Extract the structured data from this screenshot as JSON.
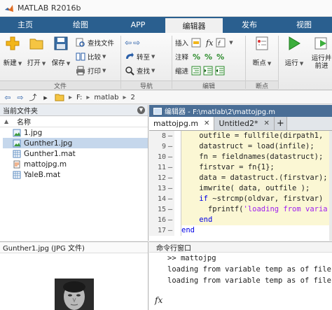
{
  "window": {
    "title": "MATLAB R2016b"
  },
  "tabs": [
    {
      "label": "主页",
      "active": false
    },
    {
      "label": "绘图",
      "active": false
    },
    {
      "label": "APP",
      "active": false
    },
    {
      "label": "编辑器",
      "active": true
    },
    {
      "label": "发布",
      "active": false
    },
    {
      "label": "视图",
      "active": false
    }
  ],
  "ribbon": {
    "new_label": "新建",
    "open_label": "打开",
    "save_label": "保存",
    "find_files_label": "查找文件",
    "compare_label": "比较",
    "print_label": "打印",
    "goto_label": "转至",
    "find_label": "查找",
    "insert_label": "插入",
    "comment_label": "注释",
    "indent_label": "缩进",
    "breakpoints_label": "断点",
    "run_label": "运行",
    "run_advance_label": "运行并\n前进",
    "group_file": "文件",
    "group_nav": "导航",
    "group_edit": "编辑",
    "group_breakpoints": "断点"
  },
  "address": {
    "drive": "F:",
    "sep1": "▸",
    "folder1": "matlab",
    "sep2": "▸",
    "folder2": "2"
  },
  "current_folder": {
    "title": "当前文件夹",
    "column_name": "名称",
    "column_sort": "▲",
    "files": [
      {
        "name": "1.jpg",
        "type": "jpg",
        "selected": false
      },
      {
        "name": "Gunther1.jpg",
        "type": "jpg",
        "selected": true
      },
      {
        "name": "Gunther1.mat",
        "type": "mat",
        "selected": false
      },
      {
        "name": "mattojpg.m",
        "type": "m",
        "selected": false
      },
      {
        "name": "YaleB.mat",
        "type": "mat",
        "selected": false
      }
    ]
  },
  "details": {
    "title": "Gunther1.jpg  (JPG 文件)"
  },
  "editor": {
    "title": "编辑器 - F:\\matlab\\2\\mattojpg.m",
    "tabs": [
      {
        "label": "mattojpg.m",
        "active": true
      },
      {
        "label": "Untitled2*",
        "active": false
      }
    ],
    "lines": [
      {
        "num": "8",
        "text": "    outfile = fullfile(dirpath1, "
      },
      {
        "num": "9",
        "text": "    datastruct = load(infile);"
      },
      {
        "num": "10",
        "text": "    fn = fieldnames(datastruct);"
      },
      {
        "num": "11",
        "text": "    firstvar = fn{1};"
      },
      {
        "num": "12",
        "text": "    data = datastruct.(firstvar);"
      },
      {
        "num": "13",
        "text": "    imwrite( data, outfile );"
      },
      {
        "num": "14",
        "text": "    if ~strcmp(oldvar, firstvar)"
      },
      {
        "num": "15",
        "text": "      fprintf('loading from varia"
      },
      {
        "num": "16",
        "text": "    end"
      },
      {
        "num": "17",
        "text": "end"
      }
    ]
  },
  "command_window": {
    "title": "命令行窗口",
    "lines": [
      {
        "prefix": ">>",
        "text": " mattojpg"
      },
      {
        "prefix": "",
        "text": "loading from variable temp as of file"
      },
      {
        "prefix": "",
        "text": "loading from variable temp as of file"
      }
    ],
    "fx": "fx"
  }
}
